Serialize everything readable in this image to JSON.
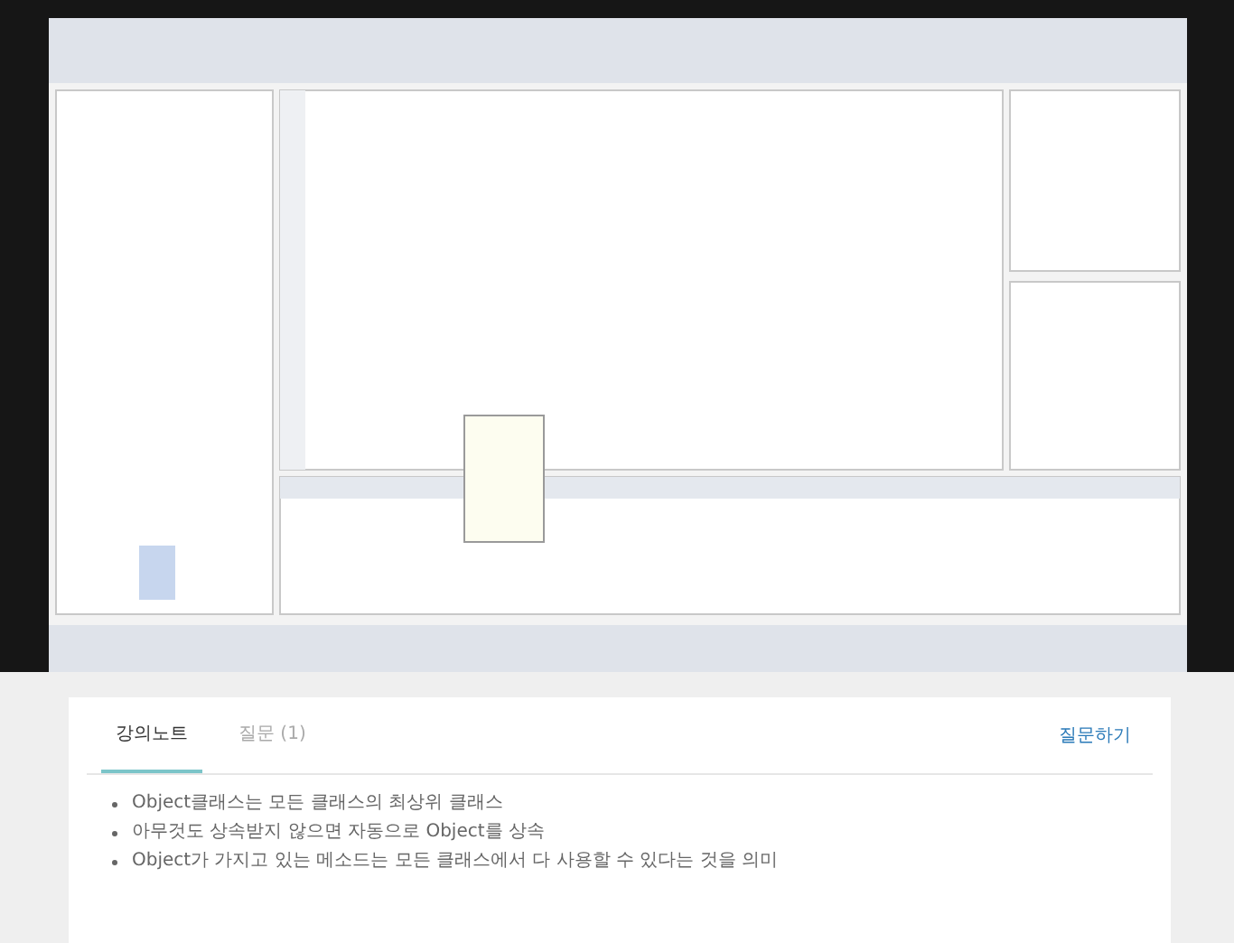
{
  "tabs": [
    {
      "label": "강의노트",
      "selected": true
    },
    {
      "label": "질문 (1)",
      "selected": false
    }
  ],
  "ask_link": "질문하기",
  "notes": [
    "Object클래스는 모든 클래스의 최상위 클래스",
    "아무것도 상속받지 않으면 자동으로 Object를 상속",
    "Object가 가지고 있는 메소드는 모든 클래스에서 다 사용할 수 있다는 것을 의미"
  ]
}
